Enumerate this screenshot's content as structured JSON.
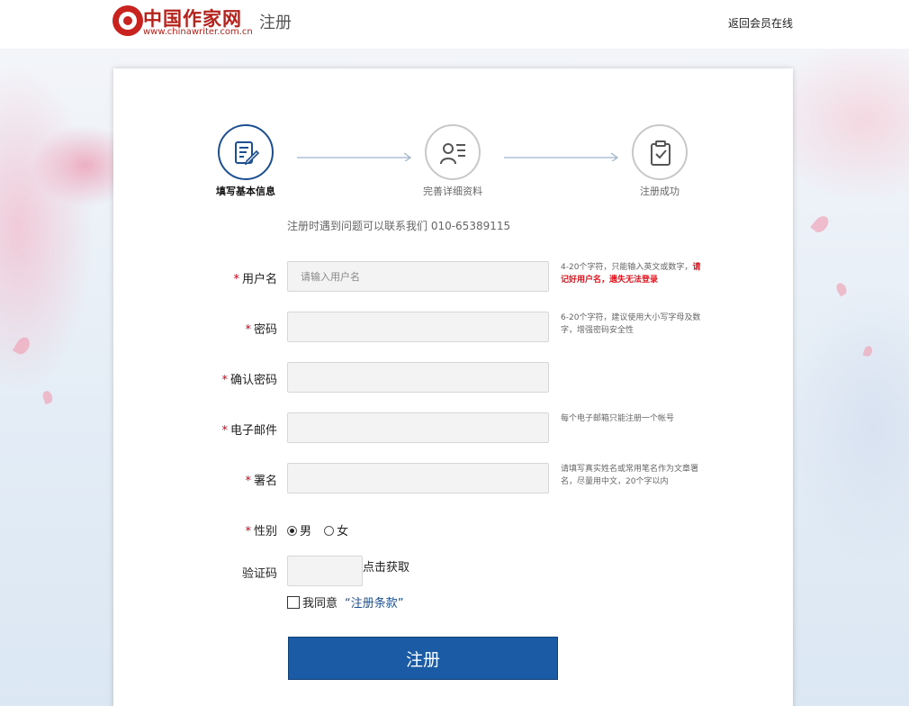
{
  "header": {
    "logo_text": "中国作家网",
    "logo_url": "www.chinawriter.com.cn",
    "page_title": "注册",
    "back_link": "返回会员在线"
  },
  "steps": [
    {
      "label": "填写基本信息",
      "icon": "edit-document-icon",
      "active": true
    },
    {
      "label": "完善详细资料",
      "icon": "profile-card-icon",
      "active": false
    },
    {
      "label": "注册成功",
      "icon": "clipboard-check-icon",
      "active": false
    }
  ],
  "notice": "注册时遇到问题可以联系我们 010-65389115",
  "form": {
    "required_mark": "*",
    "username": {
      "label": "用户名",
      "placeholder": "请输入用户名",
      "hint": "4-20个字符，只能输入英文或数字，",
      "hint_warning": "请记好用户名，遗失无法登录"
    },
    "password": {
      "label": "密码",
      "hint": "6-20个字符，建议使用大小写字母及数字，增强密码安全性"
    },
    "confirm_password": {
      "label": "确认密码"
    },
    "email": {
      "label": "电子邮件",
      "hint": "每个电子邮箱只能注册一个帐号"
    },
    "signature": {
      "label": "署名",
      "hint": "请填写真实姓名或常用笔名作为文章署名，尽量用中文，20个字以内"
    },
    "gender": {
      "label": "性别",
      "options": [
        "男",
        "女"
      ],
      "selected": "男"
    },
    "captcha": {
      "label": "验证码",
      "link": "点击获取"
    },
    "agree": {
      "label": "我同意",
      "terms": "“注册条款”",
      "checked": false
    },
    "submit_label": "注册"
  },
  "colors": {
    "brand_red": "#b5211b",
    "primary_blue": "#1b5aa5",
    "warning_red": "#e0141e"
  }
}
